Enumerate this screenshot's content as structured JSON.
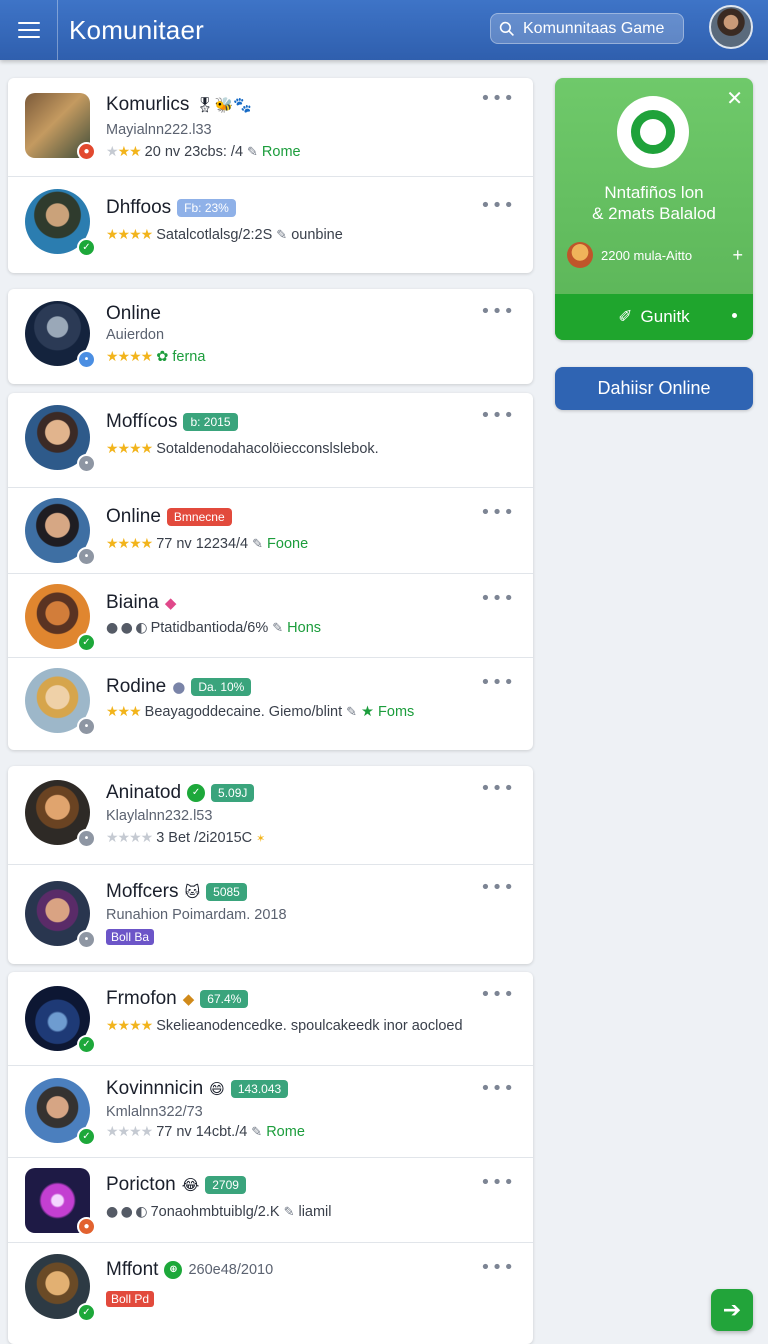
{
  "header": {
    "title": "Komunitaer",
    "search_placeholder": "Komunnitaas Game"
  },
  "rows": [
    {
      "name": "Komurlics",
      "sub": "Mayialnn222.l33",
      "rating": "20 nv 23cbs: /4",
      "link": "Rome"
    },
    {
      "name": "Dhffoos",
      "tag": "Fb: 23%",
      "meta": "Satalcotlalsg/2:2S",
      "link": "ounbine"
    },
    {
      "name": "Online",
      "sub": "Auierdon",
      "link": "ferna"
    },
    {
      "name": "Moffícos",
      "tag": "b: 2015",
      "meta": "Sotaldenodahacolöiecconslslebok."
    },
    {
      "name": "Online",
      "tag": "Bmnecne",
      "rating": "77 nv 12234/4",
      "link": "Foone"
    },
    {
      "name": "Biaina",
      "meta": "Ptatidbantioda/6%",
      "link": "Hons"
    },
    {
      "name": "Rodine",
      "tag": "Da. 10%",
      "meta": "Beayagoddecaine.",
      "meta2": "Giemo/blint",
      "link": "Foms"
    },
    {
      "name": "Aninatod",
      "tag": "5.09J",
      "sub": "Klaylalnn232.l53",
      "rating": "3 Bet /2i2015C"
    },
    {
      "name": "Moffcers",
      "tag": "5085",
      "sub": "Runahion Poimardam. 2018",
      "badge": "Boll Ba"
    },
    {
      "name": "Frmofon",
      "tag": "67.4%",
      "meta": "Skelieanodencedke. spoulcakeedk inor aocloed"
    },
    {
      "name": "Kovinnnicin",
      "tag": "143.043",
      "sub": "Kmlalnn322/73",
      "rating": "77 nv 14cbt./4",
      "link": "Rome"
    },
    {
      "name": "Poricton",
      "tag": "2709",
      "meta": "7onaohmbtuiblg/2.K",
      "link": "liamil"
    },
    {
      "name": "Mffont",
      "meta": "260e48/2010",
      "badge": "Boll Pd"
    }
  ],
  "promo": {
    "title_line1": "Nntafiños lon",
    "title_line2": "& 2mats Balalod",
    "user": "2200 mula-Aitto",
    "button": "Gunitk"
  },
  "online_button": "Dahiisr Online"
}
